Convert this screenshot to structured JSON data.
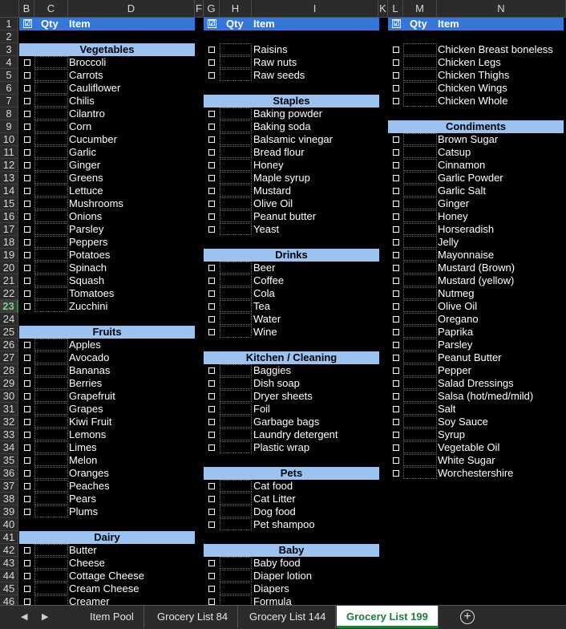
{
  "columns": [
    "",
    "B",
    "C",
    "D",
    "F",
    "G",
    "H",
    "I",
    "K",
    "L",
    "M",
    "N"
  ],
  "rows": [
    "1",
    "2",
    "3",
    "4",
    "5",
    "6",
    "7",
    "8",
    "9",
    "10",
    "11",
    "12",
    "13",
    "14",
    "15",
    "16",
    "17",
    "18",
    "19",
    "20",
    "21",
    "22",
    "23",
    "24",
    "25",
    "26",
    "27",
    "28",
    "29",
    "30",
    "31",
    "32",
    "33",
    "34",
    "35",
    "36",
    "37",
    "38",
    "39",
    "40",
    "41",
    "42",
    "43",
    "44",
    "45",
    "46"
  ],
  "selected_row": "23",
  "header": {
    "check": "☑",
    "qty": "Qty",
    "item": "Item"
  },
  "col1": [
    {
      "row": 3,
      "category": "Vegetables"
    },
    {
      "row": 4,
      "item": "Broccoli"
    },
    {
      "row": 5,
      "item": "Carrots"
    },
    {
      "row": 6,
      "item": "Cauliflower"
    },
    {
      "row": 7,
      "item": "Chilis"
    },
    {
      "row": 8,
      "item": "Cilantro"
    },
    {
      "row": 9,
      "item": "Corn"
    },
    {
      "row": 10,
      "item": "Cucumber"
    },
    {
      "row": 11,
      "item": "Garlic"
    },
    {
      "row": 12,
      "item": "Ginger"
    },
    {
      "row": 13,
      "item": "Greens"
    },
    {
      "row": 14,
      "item": "Lettuce"
    },
    {
      "row": 15,
      "item": "Mushrooms"
    },
    {
      "row": 16,
      "item": "Onions"
    },
    {
      "row": 17,
      "item": "Parsley"
    },
    {
      "row": 18,
      "item": "Peppers"
    },
    {
      "row": 19,
      "item": "Potatoes"
    },
    {
      "row": 20,
      "item": "Spinach"
    },
    {
      "row": 21,
      "item": "Squash"
    },
    {
      "row": 22,
      "item": "Tomatoes"
    },
    {
      "row": 23,
      "item": "Zucchini"
    },
    {
      "row": 25,
      "category": "Fruits"
    },
    {
      "row": 26,
      "item": "Apples"
    },
    {
      "row": 27,
      "item": "Avocado"
    },
    {
      "row": 28,
      "item": "Bananas"
    },
    {
      "row": 29,
      "item": "Berries"
    },
    {
      "row": 30,
      "item": "Grapefruit"
    },
    {
      "row": 31,
      "item": "Grapes"
    },
    {
      "row": 32,
      "item": "Kiwi Fruit"
    },
    {
      "row": 33,
      "item": "Lemons"
    },
    {
      "row": 34,
      "item": "Limes"
    },
    {
      "row": 35,
      "item": "Melon"
    },
    {
      "row": 36,
      "item": "Oranges"
    },
    {
      "row": 37,
      "item": "Peaches"
    },
    {
      "row": 38,
      "item": "Pears"
    },
    {
      "row": 39,
      "item": "Plums"
    },
    {
      "row": 41,
      "category": "Dairy"
    },
    {
      "row": 42,
      "item": "Butter"
    },
    {
      "row": 43,
      "item": "Cheese"
    },
    {
      "row": 44,
      "item": "Cottage Cheese"
    },
    {
      "row": 45,
      "item": "Cream Cheese"
    },
    {
      "row": 46,
      "item": "Creamer"
    }
  ],
  "col2": [
    {
      "row": 3,
      "item": "Raisins"
    },
    {
      "row": 4,
      "item": "Raw nuts"
    },
    {
      "row": 5,
      "item": "Raw seeds"
    },
    {
      "row": 7,
      "category": "Staples"
    },
    {
      "row": 8,
      "item": "Baking powder"
    },
    {
      "row": 9,
      "item": "Baking soda"
    },
    {
      "row": 10,
      "item": "Balsamic vinegar"
    },
    {
      "row": 11,
      "item": "Bread flour"
    },
    {
      "row": 12,
      "item": "Honey"
    },
    {
      "row": 13,
      "item": "Maple syrup"
    },
    {
      "row": 14,
      "item": "Mustard"
    },
    {
      "row": 15,
      "item": "Olive Oil"
    },
    {
      "row": 16,
      "item": "Peanut butter"
    },
    {
      "row": 17,
      "item": "Yeast"
    },
    {
      "row": 19,
      "category": "Drinks"
    },
    {
      "row": 20,
      "item": "Beer"
    },
    {
      "row": 21,
      "item": "Coffee"
    },
    {
      "row": 22,
      "item": "Cola"
    },
    {
      "row": 23,
      "item": "Tea"
    },
    {
      "row": 24,
      "item": "Water"
    },
    {
      "row": 25,
      "item": "Wine"
    },
    {
      "row": 27,
      "category": "Kitchen / Cleaning"
    },
    {
      "row": 28,
      "item": "Baggies"
    },
    {
      "row": 29,
      "item": "Dish soap"
    },
    {
      "row": 30,
      "item": "Dryer sheets"
    },
    {
      "row": 31,
      "item": "Foil"
    },
    {
      "row": 32,
      "item": "Garbage bags"
    },
    {
      "row": 33,
      "item": "Laundry detergent"
    },
    {
      "row": 34,
      "item": "Plastic wrap"
    },
    {
      "row": 36,
      "category": "Pets"
    },
    {
      "row": 37,
      "item": "Cat food"
    },
    {
      "row": 38,
      "item": "Cat Litter"
    },
    {
      "row": 39,
      "item": "Dog food"
    },
    {
      "row": 40,
      "item": "Pet shampoo"
    },
    {
      "row": 42,
      "category": "Baby"
    },
    {
      "row": 43,
      "item": "Baby food"
    },
    {
      "row": 44,
      "item": "Diaper lotion"
    },
    {
      "row": 45,
      "item": "Diapers"
    },
    {
      "row": 46,
      "item": "Formula"
    }
  ],
  "col3": [
    {
      "row": 3,
      "item": "Chicken Breast boneless"
    },
    {
      "row": 4,
      "item": "Chicken Legs"
    },
    {
      "row": 5,
      "item": "Chicken Thighs"
    },
    {
      "row": 6,
      "item": "Chicken Wings"
    },
    {
      "row": 7,
      "item": "Chicken Whole"
    },
    {
      "row": 9,
      "category": "Condiments"
    },
    {
      "row": 10,
      "item": "Brown Sugar"
    },
    {
      "row": 11,
      "item": "Catsup"
    },
    {
      "row": 12,
      "item": "Cinnamon"
    },
    {
      "row": 13,
      "item": "Garlic Powder"
    },
    {
      "row": 14,
      "item": "Garlic Salt"
    },
    {
      "row": 15,
      "item": "Ginger"
    },
    {
      "row": 16,
      "item": "Honey"
    },
    {
      "row": 17,
      "item": "Horseradish"
    },
    {
      "row": 18,
      "item": "Jelly"
    },
    {
      "row": 19,
      "item": "Mayonnaise"
    },
    {
      "row": 20,
      "item": "Mustard (Brown)"
    },
    {
      "row": 21,
      "item": "Mustard (yellow)"
    },
    {
      "row": 22,
      "item": "Nutmeg"
    },
    {
      "row": 23,
      "item": "Olive Oil"
    },
    {
      "row": 24,
      "item": "Oregano"
    },
    {
      "row": 25,
      "item": "Paprika"
    },
    {
      "row": 26,
      "item": "Parsley"
    },
    {
      "row": 27,
      "item": "Peanut Butter"
    },
    {
      "row": 28,
      "item": "Pepper"
    },
    {
      "row": 29,
      "item": "Salad Dressings"
    },
    {
      "row": 30,
      "item": "Salsa (hot/med/mild)"
    },
    {
      "row": 31,
      "item": "Salt"
    },
    {
      "row": 32,
      "item": "Soy Sauce"
    },
    {
      "row": 33,
      "item": "Syrup"
    },
    {
      "row": 34,
      "item": "Vegetable Oil"
    },
    {
      "row": 35,
      "item": "White Sugar"
    },
    {
      "row": 36,
      "item": "Worchestershire"
    }
  ],
  "tabs": [
    "Item Pool",
    "Grocery List 84",
    "Grocery List 144",
    "Grocery List 199"
  ],
  "active_tab": "Grocery List 199",
  "tabnav": {
    "prev": "◀",
    "next": "▶",
    "add": "+"
  },
  "colors": {
    "header_band": "#3576d6",
    "category_band": "#9cc3f0",
    "active_tab_text": "#1e7c3a"
  }
}
